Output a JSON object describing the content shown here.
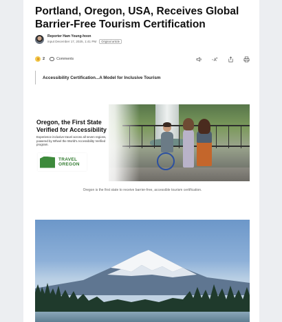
{
  "article": {
    "title": "Portland, Oregon, USA, Receives Global Barrier-Free Tourism Certification",
    "reporter": "Reporter Ham Young-hoon",
    "input_date": "input December 17, 2025, 1:41 PM",
    "badge": "Original article"
  },
  "actions": {
    "like_count": "2",
    "comments_label": "Comments",
    "icons": [
      "lightbulb-icon",
      "comment-icon",
      "listen-icon",
      "font-size-icon",
      "share-icon",
      "print-icon"
    ]
  },
  "subheading": "Accessibility Certification...A Model for Inclusive Tourism",
  "banner": {
    "heading": "Oregon, the First State Verified for Accessibility",
    "subtext": "Experience inclusive travel across all seven regions, powered by Wheel the World's Accessibility Verified program.",
    "logo_line1": "TRAVEL",
    "logo_line2": "OREGON"
  },
  "caption": "Oregon is the first state to receive barrier-free, accessible tourism certification.",
  "colors": {
    "background": "#eceef1",
    "logo_green": "#3d8a3b"
  }
}
